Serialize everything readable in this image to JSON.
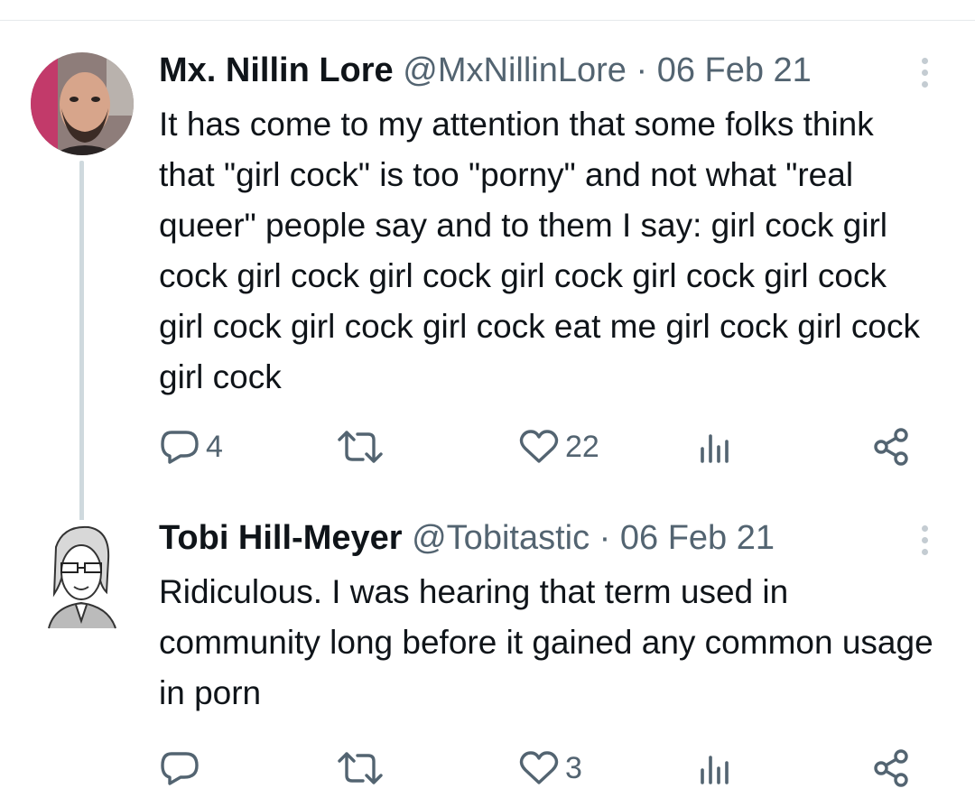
{
  "thread": {
    "tweets": [
      {
        "author_name": "Mx. Nillin Lore",
        "handle": "@MxNillinLore",
        "separator": "·",
        "date": "06 Feb 21",
        "text": "It has come to my attention that some folks think that \"girl cock\" is too \"porny\" and not what \"real queer\" people say and to them I say: girl cock girl cock girl cock girl cock girl cock girl cock girl cock girl cock girl cock girl cock eat me girl cock girl cock girl cock",
        "replies": "4",
        "retweets": "",
        "likes": "22",
        "views": ""
      },
      {
        "author_name": "Tobi Hill-Meyer",
        "handle": "@Tobitastic",
        "separator": "·",
        "date": "06 Feb 21",
        "text": "Ridiculous. I was hearing that term used in community long before it gained any common usage in porn",
        "replies": "",
        "retweets": "",
        "likes": "3",
        "views": ""
      }
    ]
  },
  "icons": {
    "reply": "reply-icon",
    "retweet": "retweet-icon",
    "like": "heart-icon",
    "views": "views-icon",
    "share": "share-icon",
    "more": "more-icon"
  },
  "colors": {
    "text": "#0f1419",
    "secondary": "#536471",
    "thread_line": "#cfd9de"
  }
}
